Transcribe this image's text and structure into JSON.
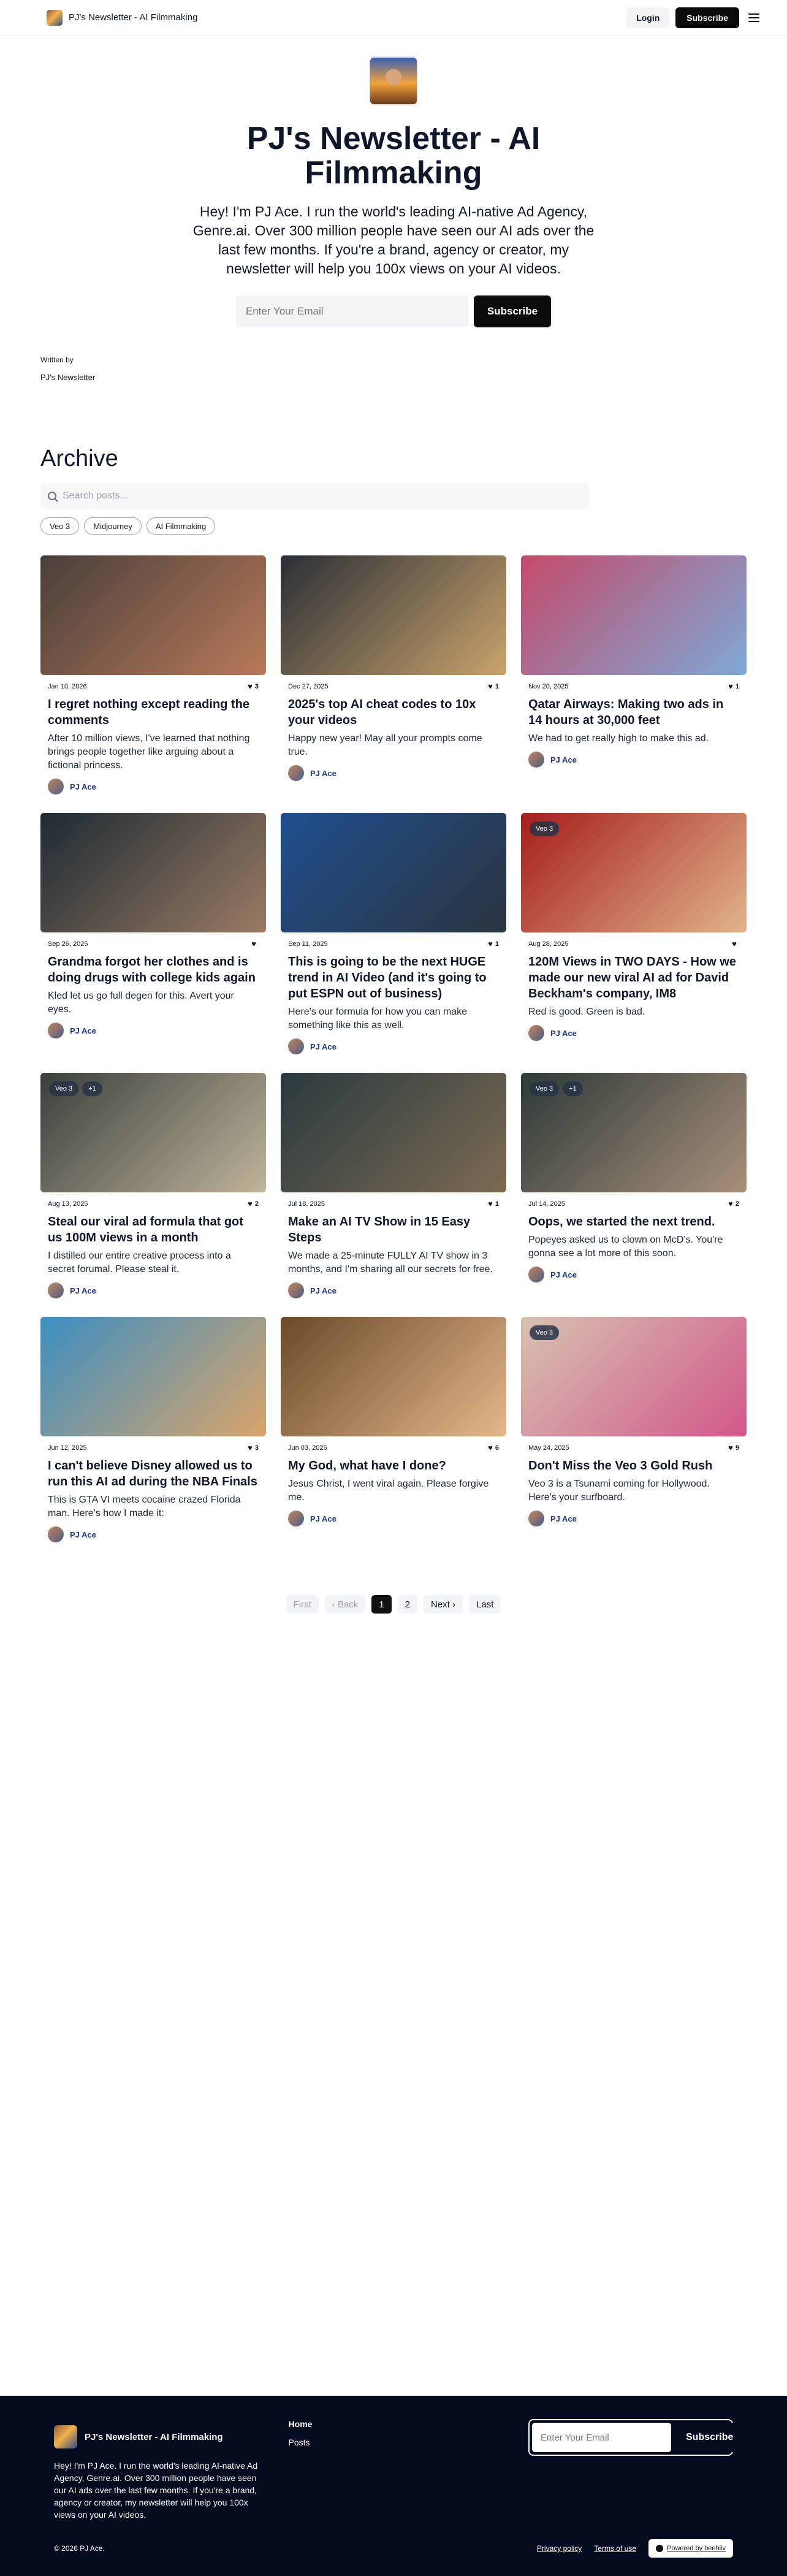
{
  "nav": {
    "brand": "PJ's Newsletter - AI Filmmaking",
    "login": "Login",
    "subscribe": "Subscribe"
  },
  "hero": {
    "title": "PJ's Newsletter - AI Filmmaking",
    "description": "Hey! I'm PJ Ace. I run the world's leading AI-native Ad Agency, Genre.ai. Over 300 million people have seen our AI ads over the last few months. If you're a brand, agency or creator, my newsletter will help you 100x views on your AI videos.",
    "email_placeholder": "Enter Your Email",
    "subscribe": "Subscribe"
  },
  "author": {
    "label": "Written by",
    "name": "PJ's Newsletter"
  },
  "archive": {
    "title": "Archive",
    "search_placeholder": "Search posts...",
    "tags": [
      "Veo 3",
      "Midjourney",
      "AI Filmmaking"
    ]
  },
  "posts": [
    {
      "date": "Jan 10, 2026",
      "likes": "3",
      "title": "I regret nothing except reading the comments",
      "subtitle": "After 10 million views, I've learned that nothing brings people together like arguing about a fictional princess.",
      "author": "PJ Ace",
      "badges": [],
      "colors": [
        "#4a3f3a",
        "#b8795a"
      ]
    },
    {
      "date": "Dec 27, 2025",
      "likes": "1",
      "title": "2025's top AI cheat codes to 10x your videos",
      "subtitle": "Happy new year! May all your prompts come true.",
      "author": "PJ Ace",
      "badges": [],
      "colors": [
        "#2b2f36",
        "#c9a36b"
      ]
    },
    {
      "date": "Nov 20, 2025",
      "likes": "1",
      "title": "Qatar Airways: Making two ads in 14 hours at 30,000 feet",
      "subtitle": "We had to get really high to make this ad.",
      "author": "PJ Ace",
      "badges": [],
      "colors": [
        "#c44a6a",
        "#7ea9d6"
      ]
    },
    {
      "date": "Sep 26, 2025",
      "likes": "",
      "title": "Grandma forgot her clothes and is doing drugs with college kids again",
      "subtitle": "Kled let us go full degen for this. Avert your eyes.",
      "author": "PJ Ace",
      "badges": [],
      "colors": [
        "#1d2a33",
        "#9b7b64"
      ]
    },
    {
      "date": "Sep 11, 2025",
      "likes": "1",
      "title": "This is going to be the next HUGE trend in AI Video (and it's going to put ESPN out of business)",
      "subtitle": "Here's our formula for how you can make something like this as well.",
      "author": "PJ Ace",
      "badges": [],
      "colors": [
        "#1f4f8f",
        "#2b3440"
      ]
    },
    {
      "date": "Aug 28, 2025",
      "likes": "",
      "title": "120M Views in TWO DAYS - How we made our new viral AI ad for David Beckham's company, IM8",
      "subtitle": "Red is good. Green is bad.",
      "author": "PJ Ace",
      "badges": [
        "Veo 3"
      ],
      "colors": [
        "#a51d1d",
        "#e0b48a"
      ]
    },
    {
      "date": "Aug 13, 2025",
      "likes": "2",
      "title": "Steal our viral ad formula that got us 100M views in a month",
      "subtitle": "I distilled our entire creative process into a secret forumal. Please steal it.",
      "author": "PJ Ace",
      "badges": [
        "Veo 3",
        "+1"
      ],
      "colors": [
        "#3a3f3c",
        "#c0b49a"
      ]
    },
    {
      "date": "Jul 18, 2025",
      "likes": "1",
      "title": "Make an AI TV Show in 15 Easy Steps",
      "subtitle": "We made a 25-minute FULLY AI TV show in 3 months, and I'm sharing all our secrets for free.",
      "author": "PJ Ace",
      "badges": [],
      "colors": [
        "#2a3a3f",
        "#7c6a52"
      ]
    },
    {
      "date": "Jul 14, 2025",
      "likes": "2",
      "title": "Oops, we started the next trend.",
      "subtitle": "Popeyes asked us to clown on McD's. You're gonna see a lot more of this soon.",
      "author": "PJ Ace",
      "badges": [
        "Veo 3",
        "+1"
      ],
      "colors": [
        "#2d3a38",
        "#a88f7a"
      ]
    },
    {
      "date": "Jun 12, 2025",
      "likes": "3",
      "title": "I can't believe Disney allowed us to run this AI ad during the NBA Finals",
      "subtitle": "This is GTA VI meets cocaine crazed Florida man. Here's how I made it:",
      "author": "PJ Ace",
      "badges": [],
      "colors": [
        "#3c8fc2",
        "#d8a46a"
      ]
    },
    {
      "date": "Jun 03, 2025",
      "likes": "6",
      "title": "My God, what have I done?",
      "subtitle": "Jesus Christ, I went viral again. Please forgive me.",
      "author": "PJ Ace",
      "badges": [],
      "colors": [
        "#6a4a2a",
        "#e5b78a"
      ]
    },
    {
      "date": "May 24, 2025",
      "likes": "9",
      "title": "Don't Miss the Veo 3 Gold Rush",
      "subtitle": "Veo 3 is a Tsunami coming for Hollywood. Here's your surfboard.",
      "author": "PJ Ace",
      "badges": [
        "Veo 3"
      ],
      "colors": [
        "#d6c2b0",
        "#d2588a"
      ]
    }
  ],
  "pagination": {
    "first": "First",
    "back": "Back",
    "pages": [
      "1",
      "2"
    ],
    "current": "1",
    "next": "Next",
    "last": "Last"
  },
  "footer": {
    "brand": "PJ's Newsletter - AI Filmmaking",
    "description": "Hey! I'm PJ Ace. I run the world's leading AI-native Ad Agency, Genre.ai. Over 300 million people have seen our AI ads over the last few months. If you're a brand, agency or creator, my newsletter will help you 100x views on your AI videos.",
    "links": [
      "Home",
      "Posts"
    ],
    "email_placeholder": "Enter Your Email",
    "subscribe": "Subscribe",
    "copyright": "© 2026 PJ Ace.",
    "privacy": "Privacy policy",
    "terms": "Terms of use",
    "powered": "Powered by beehiiv"
  }
}
